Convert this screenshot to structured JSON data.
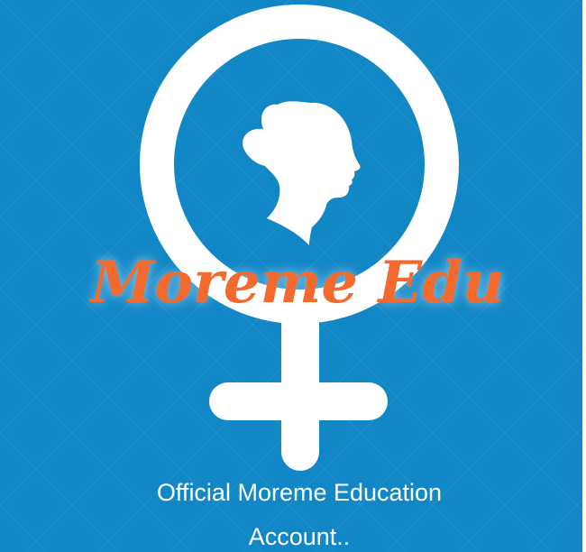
{
  "colors": {
    "background": "#1187c6",
    "symbol": "#ffffff",
    "brand": "#f26a2e",
    "tagline": "#ffffff"
  },
  "logo": {
    "brand_name": "Moreme Edu",
    "icon": "female-symbol-with-woman-silhouette"
  },
  "tagline": {
    "line1": "Official Moreme Education",
    "line2": "Account.."
  }
}
